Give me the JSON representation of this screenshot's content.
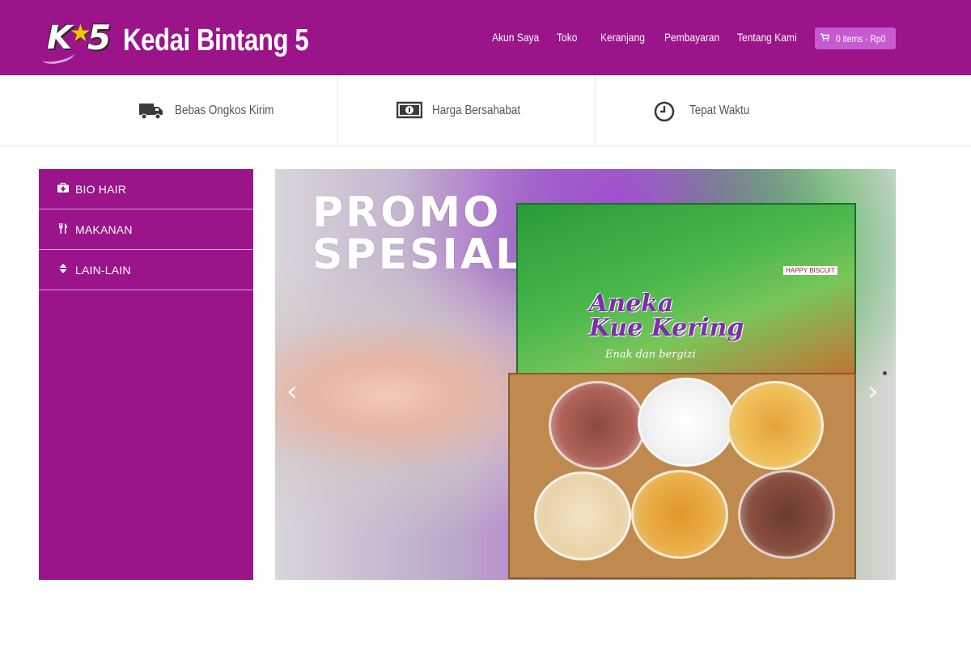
{
  "site": {
    "logo_mark": {
      "letter": "K",
      "star": "★",
      "number": "5"
    },
    "title": "Kedai Bintang 5"
  },
  "nav": {
    "items": [
      {
        "label": "Akun Saya"
      },
      {
        "label": "Toko"
      },
      {
        "label": "Keranjang"
      },
      {
        "label": "Pembayaran"
      },
      {
        "label": "Tentang Kami"
      }
    ],
    "cart": {
      "icon": "cart-icon",
      "label": "0 items - Rp0"
    }
  },
  "features": [
    {
      "icon": "truck-icon",
      "label": "Bebas Ongkos Kirim"
    },
    {
      "icon": "money-icon",
      "label": "Harga Bersahabat"
    },
    {
      "icon": "clock-icon",
      "label": "Tepat Waktu"
    }
  ],
  "sidebar": {
    "categories": [
      {
        "icon": "medkit-icon",
        "glyph": "✚",
        "label": "BIO HAIR"
      },
      {
        "icon": "cutlery-icon",
        "glyph": "🍴",
        "label": "MAKANAN"
      },
      {
        "icon": "sort-icon",
        "glyph": "⬍",
        "label": "LAIN-LAIN"
      }
    ]
  },
  "slider": {
    "headline_line1": "PROMO",
    "headline_line2": "SPESIAL",
    "product_title_line1": "Aneka",
    "product_title_line2": "Kue Kering",
    "product_subtitle": "Enak dan bergizi",
    "product_brand": "HAPPY BISCUIT",
    "prev_glyph": "‹",
    "next_glyph": "›"
  },
  "colors": {
    "brand_purple": "#9b1489",
    "cart_button": "#c65ad0",
    "text_gray": "#555555"
  }
}
